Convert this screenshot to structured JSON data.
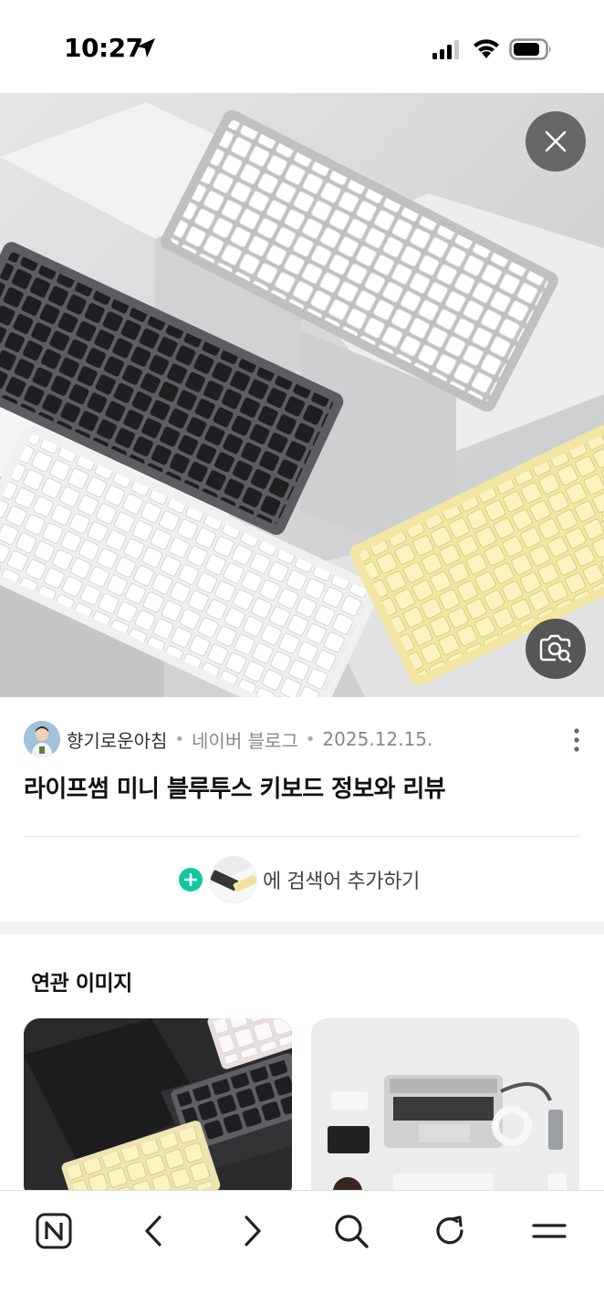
{
  "status_bar": {
    "time": "10:27",
    "icons": [
      "location-arrow-icon",
      "cellular-signal-icon",
      "wifi-icon",
      "battery-icon"
    ]
  },
  "hero": {
    "description_icons": [
      "close-icon",
      "lens-search-icon"
    ],
    "keyboard_colors": [
      "#3a3b3d",
      "#f4f4f4",
      "#f7eeb2",
      "#ffffff"
    ]
  },
  "post": {
    "author": "향기로운아침",
    "source": "네이버 블로그",
    "date": "2025.12.15.",
    "title": "라이프썸 미니 블루투스 키보드 정보와 리뷰"
  },
  "add_search": {
    "label": "에 검색어 추가하기",
    "accent": "#11c89b"
  },
  "related": {
    "title": "연관 이미지"
  },
  "toolbar": {
    "items": [
      "naver-home-icon",
      "back-icon",
      "forward-icon",
      "search-icon",
      "refresh-icon",
      "menu-icon"
    ]
  }
}
